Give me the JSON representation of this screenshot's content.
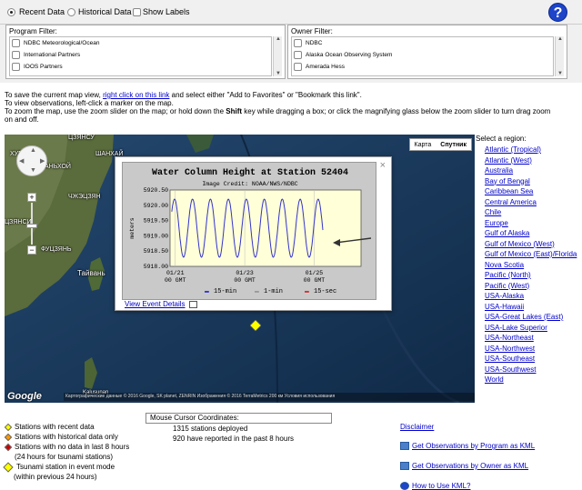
{
  "topbar": {
    "recent_label": "Recent Data",
    "historical_label": "Historical Data",
    "show_labels": "Show Labels",
    "help_glyph": "?"
  },
  "program_filter": {
    "title": "Program Filter:",
    "items": [
      "NDBC Meteorological/Ocean",
      "International Partners",
      "IOOS Partners"
    ]
  },
  "owner_filter": {
    "title": "Owner Filter:",
    "items": [
      "NDBC",
      "Alaska Ocean Observing System",
      "Amerada Hess"
    ]
  },
  "instructions": {
    "line1_pre": "To save the current map view, ",
    "line1_link": "right click on this link",
    "line1_post": " and select either \"Add to Favorites\" or \"Bookmark this link\".",
    "line2": "To view observations, left-click a marker on the map.",
    "line3_pre": "To zoom the map, use the zoom slider on the map; or hold down the ",
    "line3_bold": "Shift",
    "line3_post": " key while dragging a box; or click the magnifying glass below the zoom slider to turn drag zoom on and off."
  },
  "map": {
    "type_map": "Карта",
    "type_sat": "Спутник",
    "labels": [
      "ЦЗЯНСУ",
      "ХУБЭЙ",
      "ШАНХАЙ",
      "АНЬХОЙ",
      "ЧЖЭЦЗЯН",
      "ЦЗЯНСИ",
      "ФУЦЗЯНЬ",
      "Тайвань",
      "Kalusunan"
    ],
    "attribution": "Картографические данные © 2016 Google, SK planet, ZENRIN Изображения © 2016 TerraMetrics   200 км       Условия использования",
    "google": "Google"
  },
  "popup": {
    "close": "×",
    "event_link": "View Event Details"
  },
  "chart_data": {
    "type": "line",
    "title": "Water Column Height at Station 52404",
    "subtitle": "Image Credit: NOAA/NWS/NDBC",
    "ylabel": "meters",
    "ylim": [
      5918.0,
      5920.5
    ],
    "yticks": [
      "5920.50",
      "5920.00",
      "5919.50",
      "5919.00",
      "5918.50",
      "5918.00"
    ],
    "xticks": [
      {
        "top": "01/21",
        "bottom": "00 GMT"
      },
      {
        "top": "01/23",
        "bottom": "00 GMT"
      },
      {
        "top": "01/25",
        "bottom": "00 GMT"
      }
    ],
    "xlim": [
      0,
      5.5
    ],
    "series": [
      {
        "name": "15-min",
        "color": "#3333cc",
        "amplitude": 0.95,
        "center": 5919.25,
        "period_days": 0.517
      }
    ],
    "legend": [
      "15-min",
      "1-min",
      "15-sec"
    ],
    "legend_colors": [
      "#3333cc",
      "#999999",
      "#cc3333"
    ]
  },
  "regions": {
    "title": "Select a region:",
    "items": [
      "Atlantic (Tropical)",
      "Atlantic (West)",
      "Australia",
      "Bay of Bengal",
      "Caribbean Sea",
      "Central America",
      "Chile",
      "Europe",
      "Gulf of Alaska",
      "Gulf of Mexico (West)",
      "Gulf of Mexico (East)/Florida",
      "Nova Scotia",
      "Pacific (North)",
      "Pacific (West)",
      "USA-Alaska",
      "USA-Hawaii",
      "USA-Great Lakes (East)",
      "USA-Lake Superior",
      "USA-Northeast",
      "USA-Northwest",
      "USA-Southeast",
      "USA-Southwest",
      "World"
    ]
  },
  "legend": {
    "recent": "Stations with recent data",
    "historical": "Stations with historical data only",
    "nodata": "Stations with no data in last 8 hours",
    "nodata2": "(24 hours for tsunami stations)",
    "tsunami": "Tsunami station in event mode",
    "tsunami2": "(within previous 24 hours)",
    "colors": {
      "recent": "#ffff00",
      "historical": "#ff9900",
      "nodata": "#cc0000"
    }
  },
  "coords": {
    "label": "Mouse Cursor Coordinates:"
  },
  "stats": {
    "deployed": "1315 stations deployed",
    "reported": "920 have reported in the past 8 hours"
  },
  "links": {
    "disclaimer": "Disclaimer",
    "kml_program": "Get Observations by Program as KML",
    "kml_owner": "Get Observations by Owner as KML",
    "kml_howto": "How to Use KML?"
  }
}
